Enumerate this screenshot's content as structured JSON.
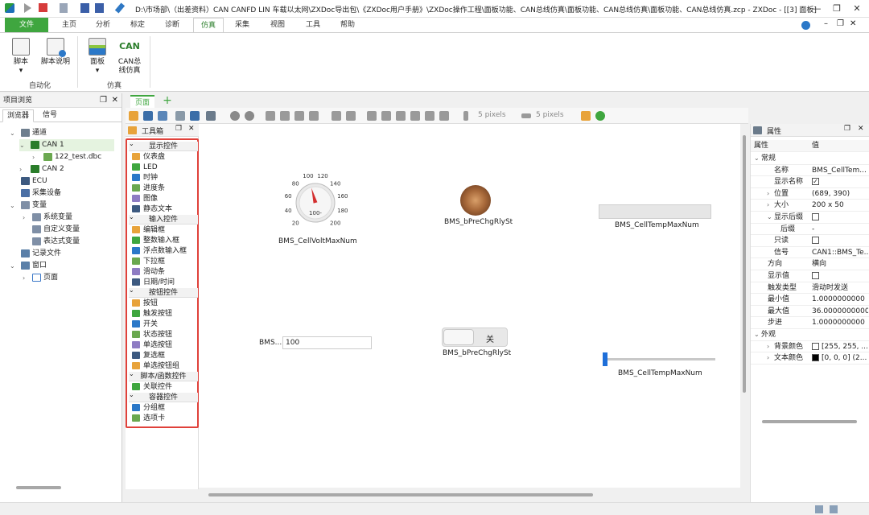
{
  "window": {
    "title": "D:\\市场部\\（出差资料）CAN CANFD LIN 车载以太网\\ZXDoc导出包\\《ZXDoc用户手册》\\ZXDoc操作工程\\面板功能、CAN总线仿真\\面板功能、CAN总线仿真\\面板功能、CAN总线仿真.zcp - ZXDoc - [[3] 面板]",
    "minimize": "—",
    "restore": "❐",
    "close": "✕"
  },
  "ribbon_tabs": [
    "文件",
    "主页",
    "分析",
    "标定",
    "诊断",
    "仿真",
    "采集",
    "视图",
    "工具",
    "帮助"
  ],
  "ribbon": {
    "buttons": [
      {
        "label": "脚本",
        "icon": "script-icon",
        "has_dropdown": true
      },
      {
        "label": "脚本说明",
        "icon": "script-help-icon"
      },
      {
        "label": "面板",
        "icon": "panel-icon",
        "has_dropdown": true
      },
      {
        "label": "CAN总线仿真",
        "line1": "CAN总",
        "line2": "线仿真",
        "icon": "can-sim-icon"
      }
    ],
    "groups": [
      "自动化",
      "仿真"
    ],
    "dropdown_arrow": "▾"
  },
  "project_browser": {
    "title": "项目浏览",
    "tabs": [
      "浏览器",
      "信号"
    ],
    "tree": [
      {
        "label": "通道",
        "icon": "channel-icon",
        "expanded": true
      },
      {
        "label": "CAN 1",
        "icon": "can-icon",
        "expanded": true,
        "selected": true
      },
      {
        "label": "122_test.dbc",
        "icon": "dbc-icon"
      },
      {
        "label": "CAN 2",
        "icon": "can-icon"
      },
      {
        "label": "ECU",
        "icon": "ecu-icon"
      },
      {
        "label": "采集设备",
        "icon": "device-icon"
      },
      {
        "label": "变量",
        "icon": "variable-icon",
        "expanded": true
      },
      {
        "label": "系统变量",
        "icon": "variable-icon"
      },
      {
        "label": "自定义变量",
        "icon": "variable-icon"
      },
      {
        "label": "表达式变量",
        "icon": "variable-icon"
      },
      {
        "label": "记录文件",
        "icon": "record-icon"
      },
      {
        "label": "窗口",
        "icon": "window-icon",
        "expanded": true
      },
      {
        "label": "页面",
        "icon": "page-icon"
      }
    ]
  },
  "doc_tab": {
    "label": "页面",
    "add": "+"
  },
  "toolbar": {
    "spacing_h": "5 pixels",
    "spacing_v": "5 pixels"
  },
  "toolbox": {
    "title": "工具箱",
    "sections": [
      {
        "title": "显示控件",
        "items": [
          "仪表盘",
          "LED",
          "时钟",
          "进度条",
          "图像",
          "静态文本"
        ]
      },
      {
        "title": "输入控件",
        "items": [
          "编辑框",
          "整数输入框",
          "浮点数输入框",
          "下拉框",
          "滑动条",
          "日期/时间"
        ]
      },
      {
        "title": "按钮控件",
        "items": [
          "按钮",
          "触发按钮",
          "开关",
          "状态按钮",
          "单选按钮",
          "复选框",
          "单选按钮组"
        ]
      },
      {
        "title": "脚本/函数控件",
        "items": [
          "关联控件"
        ]
      },
      {
        "title": "容器控件",
        "items": [
          "分组框",
          "选项卡"
        ]
      }
    ]
  },
  "canvas": {
    "gauge": {
      "caption": "BMS_CellVoltMaxNum",
      "value": 100,
      "ticks": [
        "20",
        "40",
        "60",
        "80",
        "100",
        "120",
        "140",
        "160",
        "180",
        "200"
      ],
      "center_label": "100-"
    },
    "led": {
      "caption": "BMS_bPreChgRlySt"
    },
    "progress": {
      "caption": "BMS_CellTempMaxNum",
      "value": 0
    },
    "editbox": {
      "label": "BMS...",
      "value": "100"
    },
    "switch": {
      "caption": "BMS_bPreChgRlySt",
      "state_label": "关"
    },
    "slider": {
      "caption": "BMS_CellTempMaxNum",
      "value": 0
    }
  },
  "properties": {
    "title": "属性",
    "col_name": "属性",
    "col_value": "值",
    "rows": [
      {
        "k": "常规",
        "v": "",
        "type": "group",
        "expander": "⌄"
      },
      {
        "k": "名称",
        "v": "BMS_CellTem...",
        "indent": 2
      },
      {
        "k": "显示名称",
        "v": "✓",
        "type": "check",
        "checked": true,
        "indent": 2
      },
      {
        "k": "位置",
        "v": "(689, 390)",
        "indent": 2,
        "expander": "›"
      },
      {
        "k": "大小",
        "v": "200 x 50",
        "indent": 2,
        "expander": "›"
      },
      {
        "k": "显示后缀",
        "v": "",
        "type": "check",
        "checked": false,
        "indent": 2,
        "expander": "⌄"
      },
      {
        "k": "后缀",
        "v": "-",
        "indent": 3
      },
      {
        "k": "只读",
        "v": "",
        "type": "check",
        "checked": false,
        "indent": 2
      },
      {
        "k": "信号",
        "v": "CAN1::BMS_Te...",
        "indent": 2
      },
      {
        "k": "方向",
        "v": "横向",
        "indent": 1
      },
      {
        "k": "显示值",
        "v": "",
        "type": "check",
        "checked": false,
        "indent": 1
      },
      {
        "k": "触发类型",
        "v": "滑动时发送",
        "indent": 1
      },
      {
        "k": "最小值",
        "v": "1.0000000000",
        "indent": 1
      },
      {
        "k": "最大值",
        "v": "36.0000000000",
        "indent": 1
      },
      {
        "k": "步进",
        "v": "1.0000000000",
        "indent": 1
      },
      {
        "k": "外观",
        "v": "",
        "type": "group",
        "expander": "⌄"
      },
      {
        "k": "背景颜色",
        "v": "[255, 255, ...",
        "swatch": "#ffffff",
        "indent": 2,
        "expander": "›"
      },
      {
        "k": "文本颜色",
        "v": "[0, 0, 0] (2...",
        "swatch": "#000000",
        "indent": 2,
        "expander": "›"
      }
    ]
  },
  "colors": {
    "accent_green": "#3fa63f",
    "highlight_red": "#e0413a",
    "slider_blue": "#1e6fd9"
  }
}
